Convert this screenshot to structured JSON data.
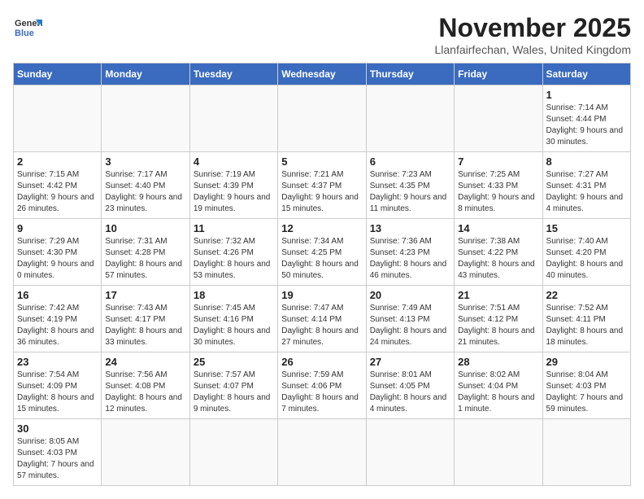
{
  "header": {
    "logo_line1": "General",
    "logo_line2": "Blue",
    "title": "November 2025",
    "subtitle": "Llanfairfechan, Wales, United Kingdom"
  },
  "days_of_week": [
    "Sunday",
    "Monday",
    "Tuesday",
    "Wednesday",
    "Thursday",
    "Friday",
    "Saturday"
  ],
  "weeks": [
    [
      {
        "day": "",
        "info": ""
      },
      {
        "day": "",
        "info": ""
      },
      {
        "day": "",
        "info": ""
      },
      {
        "day": "",
        "info": ""
      },
      {
        "day": "",
        "info": ""
      },
      {
        "day": "",
        "info": ""
      },
      {
        "day": "1",
        "info": "Sunrise: 7:14 AM\nSunset: 4:44 PM\nDaylight: 9 hours\nand 30 minutes."
      }
    ],
    [
      {
        "day": "2",
        "info": "Sunrise: 7:15 AM\nSunset: 4:42 PM\nDaylight: 9 hours\nand 26 minutes."
      },
      {
        "day": "3",
        "info": "Sunrise: 7:17 AM\nSunset: 4:40 PM\nDaylight: 9 hours\nand 23 minutes."
      },
      {
        "day": "4",
        "info": "Sunrise: 7:19 AM\nSunset: 4:39 PM\nDaylight: 9 hours\nand 19 minutes."
      },
      {
        "day": "5",
        "info": "Sunrise: 7:21 AM\nSunset: 4:37 PM\nDaylight: 9 hours\nand 15 minutes."
      },
      {
        "day": "6",
        "info": "Sunrise: 7:23 AM\nSunset: 4:35 PM\nDaylight: 9 hours\nand 11 minutes."
      },
      {
        "day": "7",
        "info": "Sunrise: 7:25 AM\nSunset: 4:33 PM\nDaylight: 9 hours\nand 8 minutes."
      },
      {
        "day": "8",
        "info": "Sunrise: 7:27 AM\nSunset: 4:31 PM\nDaylight: 9 hours\nand 4 minutes."
      }
    ],
    [
      {
        "day": "9",
        "info": "Sunrise: 7:29 AM\nSunset: 4:30 PM\nDaylight: 9 hours\nand 0 minutes."
      },
      {
        "day": "10",
        "info": "Sunrise: 7:31 AM\nSunset: 4:28 PM\nDaylight: 8 hours\nand 57 minutes."
      },
      {
        "day": "11",
        "info": "Sunrise: 7:32 AM\nSunset: 4:26 PM\nDaylight: 8 hours\nand 53 minutes."
      },
      {
        "day": "12",
        "info": "Sunrise: 7:34 AM\nSunset: 4:25 PM\nDaylight: 8 hours\nand 50 minutes."
      },
      {
        "day": "13",
        "info": "Sunrise: 7:36 AM\nSunset: 4:23 PM\nDaylight: 8 hours\nand 46 minutes."
      },
      {
        "day": "14",
        "info": "Sunrise: 7:38 AM\nSunset: 4:22 PM\nDaylight: 8 hours\nand 43 minutes."
      },
      {
        "day": "15",
        "info": "Sunrise: 7:40 AM\nSunset: 4:20 PM\nDaylight: 8 hours\nand 40 minutes."
      }
    ],
    [
      {
        "day": "16",
        "info": "Sunrise: 7:42 AM\nSunset: 4:19 PM\nDaylight: 8 hours\nand 36 minutes."
      },
      {
        "day": "17",
        "info": "Sunrise: 7:43 AM\nSunset: 4:17 PM\nDaylight: 8 hours\nand 33 minutes."
      },
      {
        "day": "18",
        "info": "Sunrise: 7:45 AM\nSunset: 4:16 PM\nDaylight: 8 hours\nand 30 minutes."
      },
      {
        "day": "19",
        "info": "Sunrise: 7:47 AM\nSunset: 4:14 PM\nDaylight: 8 hours\nand 27 minutes."
      },
      {
        "day": "20",
        "info": "Sunrise: 7:49 AM\nSunset: 4:13 PM\nDaylight: 8 hours\nand 24 minutes."
      },
      {
        "day": "21",
        "info": "Sunrise: 7:51 AM\nSunset: 4:12 PM\nDaylight: 8 hours\nand 21 minutes."
      },
      {
        "day": "22",
        "info": "Sunrise: 7:52 AM\nSunset: 4:11 PM\nDaylight: 8 hours\nand 18 minutes."
      }
    ],
    [
      {
        "day": "23",
        "info": "Sunrise: 7:54 AM\nSunset: 4:09 PM\nDaylight: 8 hours\nand 15 minutes."
      },
      {
        "day": "24",
        "info": "Sunrise: 7:56 AM\nSunset: 4:08 PM\nDaylight: 8 hours\nand 12 minutes."
      },
      {
        "day": "25",
        "info": "Sunrise: 7:57 AM\nSunset: 4:07 PM\nDaylight: 8 hours\nand 9 minutes."
      },
      {
        "day": "26",
        "info": "Sunrise: 7:59 AM\nSunset: 4:06 PM\nDaylight: 8 hours\nand 7 minutes."
      },
      {
        "day": "27",
        "info": "Sunrise: 8:01 AM\nSunset: 4:05 PM\nDaylight: 8 hours\nand 4 minutes."
      },
      {
        "day": "28",
        "info": "Sunrise: 8:02 AM\nSunset: 4:04 PM\nDaylight: 8 hours\nand 1 minute."
      },
      {
        "day": "29",
        "info": "Sunrise: 8:04 AM\nSunset: 4:03 PM\nDaylight: 7 hours\nand 59 minutes."
      }
    ],
    [
      {
        "day": "30",
        "info": "Sunrise: 8:05 AM\nSunset: 4:03 PM\nDaylight: 7 hours\nand 57 minutes."
      },
      {
        "day": "",
        "info": ""
      },
      {
        "day": "",
        "info": ""
      },
      {
        "day": "",
        "info": ""
      },
      {
        "day": "",
        "info": ""
      },
      {
        "day": "",
        "info": ""
      },
      {
        "day": "",
        "info": ""
      }
    ]
  ]
}
